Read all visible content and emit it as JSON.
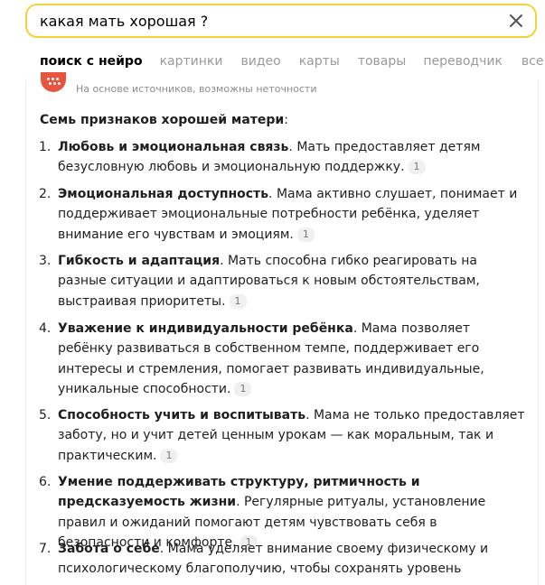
{
  "search": {
    "query": "какая мать хорошая ?"
  },
  "tabs": [
    {
      "label": "поиск с нейро"
    },
    {
      "label": "картинки"
    },
    {
      "label": "видео"
    },
    {
      "label": "карты"
    },
    {
      "label": "товары"
    },
    {
      "label": "переводчик"
    },
    {
      "label": "все"
    }
  ],
  "answer": {
    "disclaimer": "На основе источников, возможны неточности",
    "heading": "Семь признаков хорошей матери",
    "heading_colon": ":",
    "items": [
      {
        "num": "1.",
        "title": "Любовь и эмоциональная связь",
        "text": ". Мать предоставляет детям безусловную любовь и эмоциональную поддержку.",
        "ref": "1"
      },
      {
        "num": "2.",
        "title": "Эмоциональная доступность",
        "text": ". Мама активно слушает, понимает и поддерживает эмоциональные потребности ребёнка, уделяет внимание его чувствам и эмоциям.",
        "ref": "1"
      },
      {
        "num": "3.",
        "title": "Гибкость и адаптация",
        "text": ". Мать способна гибко реагировать на разные ситуации и адаптироваться к новым обстоятельствам, выстраивая приоритеты.",
        "ref": "1"
      },
      {
        "num": "4.",
        "title": "Уважение к индивидуальности ребёнка",
        "text": ". Мама позволяет ребёнку развиваться в собственном темпе, поддерживает его интересы и стремления, помогает развивать индивидуальные, уникальные способности.",
        "ref": "1"
      },
      {
        "num": "5.",
        "title": "Способность учить и воспитывать",
        "text": ". Мама не только предоставляет заботу, но и учит детей ценным урокам — как моральным, так и практическим.",
        "ref": "1"
      },
      {
        "num": "6.",
        "title": "Умение поддерживать структуру, ритмичность и предсказуемость жизни",
        "text": ". Регулярные ритуалы, установление правил и ожиданий помогают детям чувствовать себя в безопасности и комфорте.",
        "ref": "1"
      },
      {
        "num": "7.",
        "title": "Забота о себе",
        "text": ". Мама уделяет внимание своему физическому и психологическому благополучию, чтобы сохранять уровень",
        "ref": ""
      }
    ]
  },
  "icons": {
    "clear": "close-icon",
    "brand": "neuro-logo-icon"
  },
  "colors": {
    "search_border": "#f2d338",
    "brand": "#e8543f",
    "muted": "#9a9a9a"
  }
}
